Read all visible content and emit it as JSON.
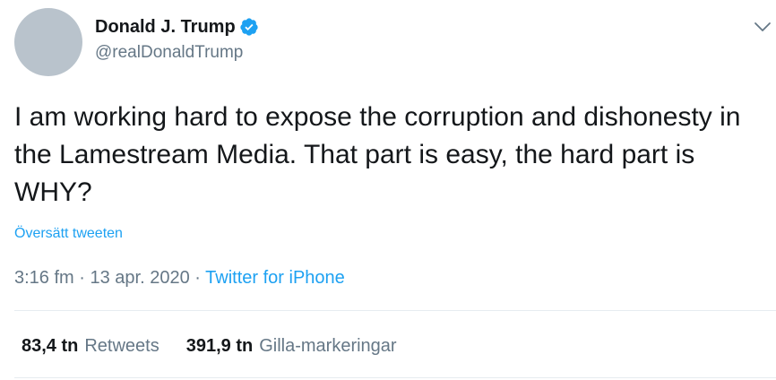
{
  "author": {
    "display_name": "Donald J. Trump",
    "handle": "@realDonaldTrump",
    "verified": true,
    "verified_icon": "verified-badge-icon"
  },
  "tweet": {
    "text": "I am working hard to expose the corruption and dishonesty in the Lamestream Media. That part is easy, the hard part is WHY?",
    "translate_label": "Översätt tweeten"
  },
  "meta": {
    "time": "3:16 fm",
    "separator": "·",
    "date": "13 apr. 2020",
    "source": "Twitter for iPhone"
  },
  "stats": {
    "retweets_count": "83,4 tn",
    "retweets_label": "Retweets",
    "likes_count": "391,9 tn",
    "likes_label": "Gilla-markeringar"
  },
  "colors": {
    "link": "#1da1f2",
    "secondary_text": "#657786",
    "primary_text": "#14171a",
    "avatar_placeholder": "#b9c3cc",
    "divider": "#e6ecf0"
  }
}
